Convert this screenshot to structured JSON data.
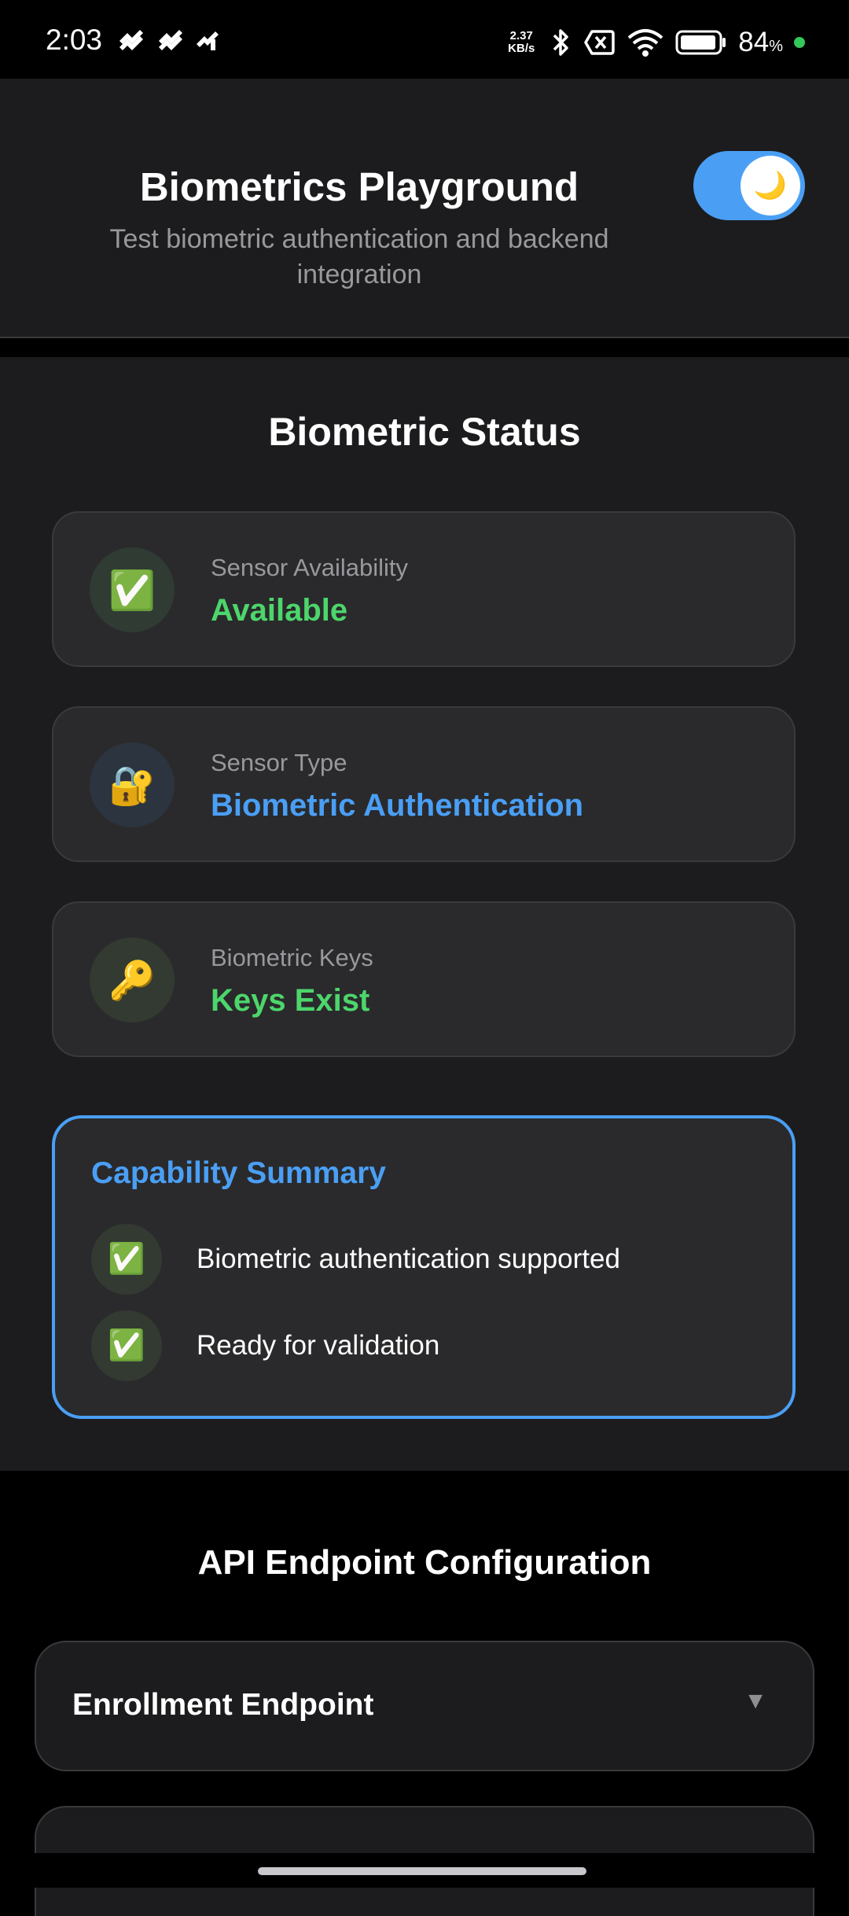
{
  "status_bar": {
    "time": "2:03",
    "net_speed_value": "2.37",
    "net_speed_unit": "KB/s",
    "battery": "84",
    "battery_unit": "%",
    "icons": [
      "notification-icon",
      "notification-icon",
      "notification-icon",
      "bluetooth-icon",
      "no-sim-icon",
      "wifi-icon",
      "battery-icon"
    ]
  },
  "header": {
    "title": "Biometrics Playground",
    "subtitle": "Test biometric authentication and backend integration",
    "theme_toggle_icon": "🌙",
    "theme_toggle_on": true
  },
  "status": {
    "title": "Biometric Status",
    "cards": [
      {
        "icon": "✅",
        "label": "Sensor Availability",
        "value": "Available",
        "color": "#4cd66b"
      },
      {
        "icon": "🔐",
        "label": "Sensor Type",
        "value": "Biometric Authentication",
        "color": "#4a9ff5"
      },
      {
        "icon": "🔑",
        "label": "Biometric Keys",
        "value": "Keys Exist",
        "color": "#4cd66b"
      }
    ]
  },
  "summary": {
    "title": "Capability Summary",
    "items": [
      {
        "icon": "✅",
        "text": "Biometric authentication supported"
      },
      {
        "icon": "✅",
        "text": "Ready for validation"
      }
    ]
  },
  "api": {
    "title": "API Endpoint Configuration",
    "endpoints": [
      {
        "label": "Enrollment Endpoint",
        "chevron": "▼"
      }
    ]
  },
  "colors": {
    "accent": "#4a9ff5",
    "success": "#4cd66b",
    "surface": "#1c1c1e",
    "card": "#2a2a2c"
  }
}
